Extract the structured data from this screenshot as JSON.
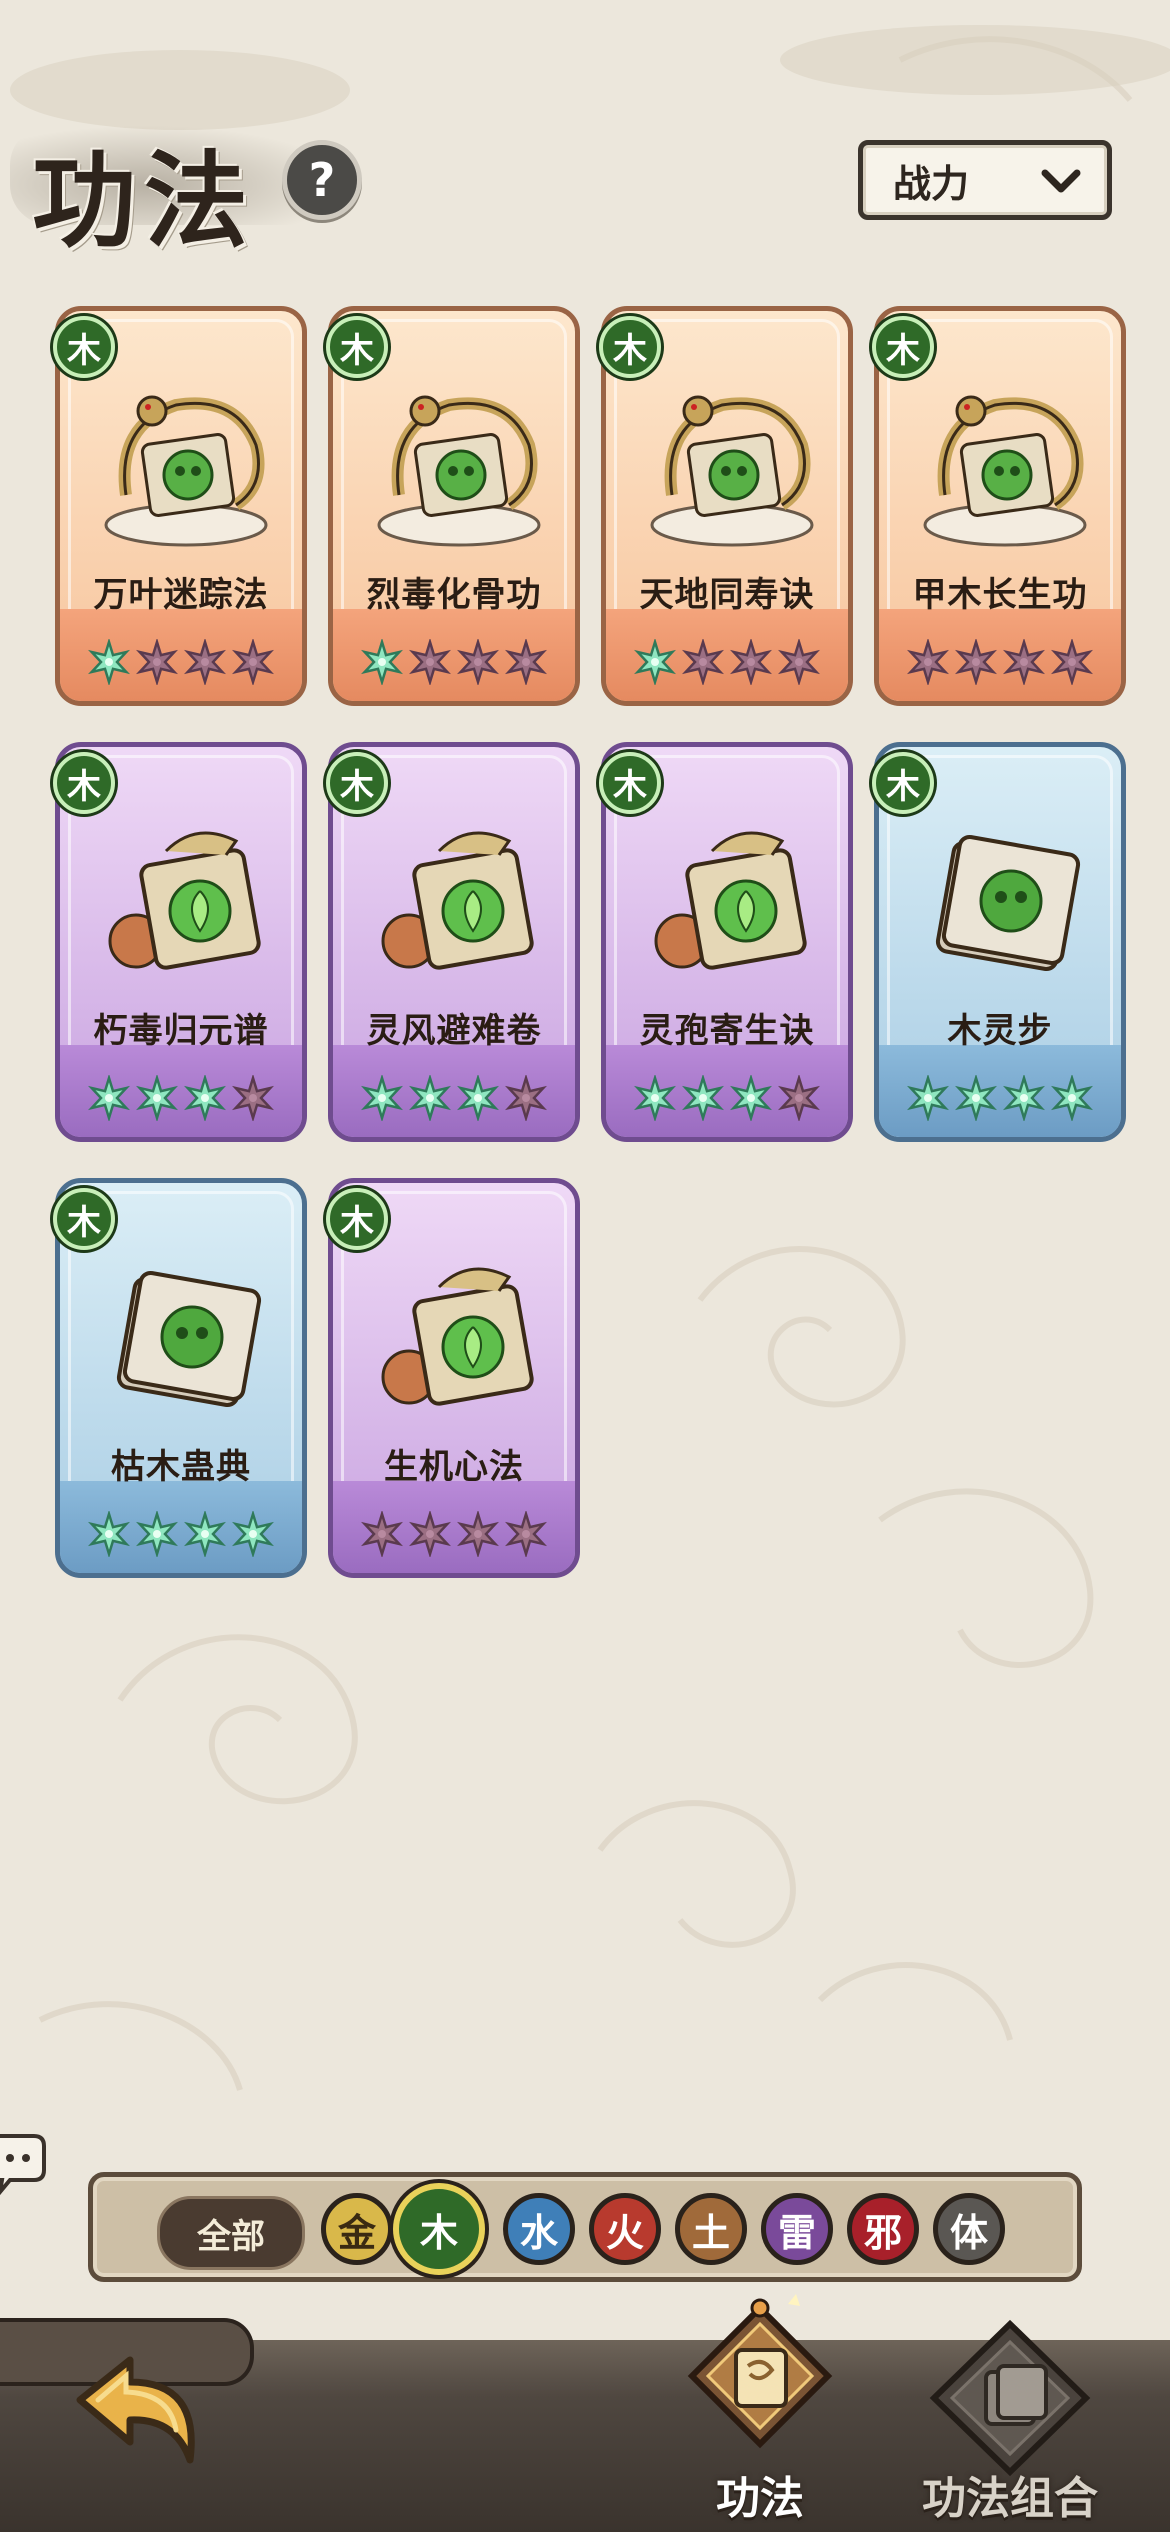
{
  "header": {
    "title": "功法",
    "help_symbol": "?",
    "sort": {
      "selected": "战力"
    }
  },
  "cards": [
    {
      "name": "万叶迷踪法",
      "element": "木",
      "rarity": "orange",
      "stars_lit": 1,
      "stars_total": 4,
      "art_icon": "leaf-scroll-icon"
    },
    {
      "name": "烈毒化骨功",
      "element": "木",
      "rarity": "orange",
      "stars_lit": 1,
      "stars_total": 4,
      "art_icon": "poison-skull-icon"
    },
    {
      "name": "天地同寿诀",
      "element": "木",
      "rarity": "orange",
      "stars_lit": 1,
      "stars_total": 4,
      "art_icon": "sprout-icon"
    },
    {
      "name": "甲木长生功",
      "element": "木",
      "rarity": "orange",
      "stars_lit": 0,
      "stars_total": 4,
      "art_icon": "tree-icon"
    },
    {
      "name": "朽毒归元谱",
      "element": "木",
      "rarity": "purple",
      "stars_lit": 3,
      "stars_total": 4,
      "art_icon": "poison-skull-icon"
    },
    {
      "name": "灵风避难卷",
      "element": "木",
      "rarity": "purple",
      "stars_lit": 3,
      "stars_total": 4,
      "art_icon": "leaf-icon"
    },
    {
      "name": "灵孢寄生诀",
      "element": "木",
      "rarity": "purple",
      "stars_lit": 3,
      "stars_total": 4,
      "art_icon": "spore-creature-icon"
    },
    {
      "name": "木灵步",
      "element": "木",
      "rarity": "blue",
      "stars_lit": 4,
      "stars_total": 4,
      "art_icon": "leaf-book-icon"
    },
    {
      "name": "枯木蛊典",
      "element": "木",
      "rarity": "blue",
      "stars_lit": 4,
      "stars_total": 4,
      "art_icon": "skull-book-icon"
    },
    {
      "name": "生机心法",
      "element": "木",
      "rarity": "purple",
      "stars_lit": 0,
      "stars_total": 4,
      "art_icon": "heart-leaf-icon"
    }
  ],
  "filter": {
    "all_label": "全部",
    "elements": [
      {
        "label": "金",
        "color": "#d9b84a",
        "text_color": "#3a2a12"
      },
      {
        "label": "木",
        "color": "#2f6a28",
        "text_color": "#ffffff",
        "active": true
      },
      {
        "label": "水",
        "color": "#3f7fb8",
        "text_color": "#ffffff"
      },
      {
        "label": "火",
        "color": "#b83a2e",
        "text_color": "#ffffff"
      },
      {
        "label": "土",
        "color": "#a06a3a",
        "text_color": "#ffffff"
      },
      {
        "label": "雷",
        "color": "#7a4a9a",
        "text_color": "#ffffff"
      },
      {
        "label": "邪",
        "color": "#a8202a",
        "text_color": "#ffffff"
      },
      {
        "label": "体",
        "color": "#5a5753",
        "text_color": "#ffffff"
      }
    ]
  },
  "nav": {
    "tab_gongfa": "功法",
    "tab_combo": "功法组合"
  },
  "colors": {
    "orange_card": "#f7c49c",
    "purple_card": "#c8a3e0",
    "blue_card": "#a9cde4",
    "wood_green": "#2f6a28",
    "star_lit": "#8fe6c0",
    "star_dim": "#9b6f83"
  }
}
